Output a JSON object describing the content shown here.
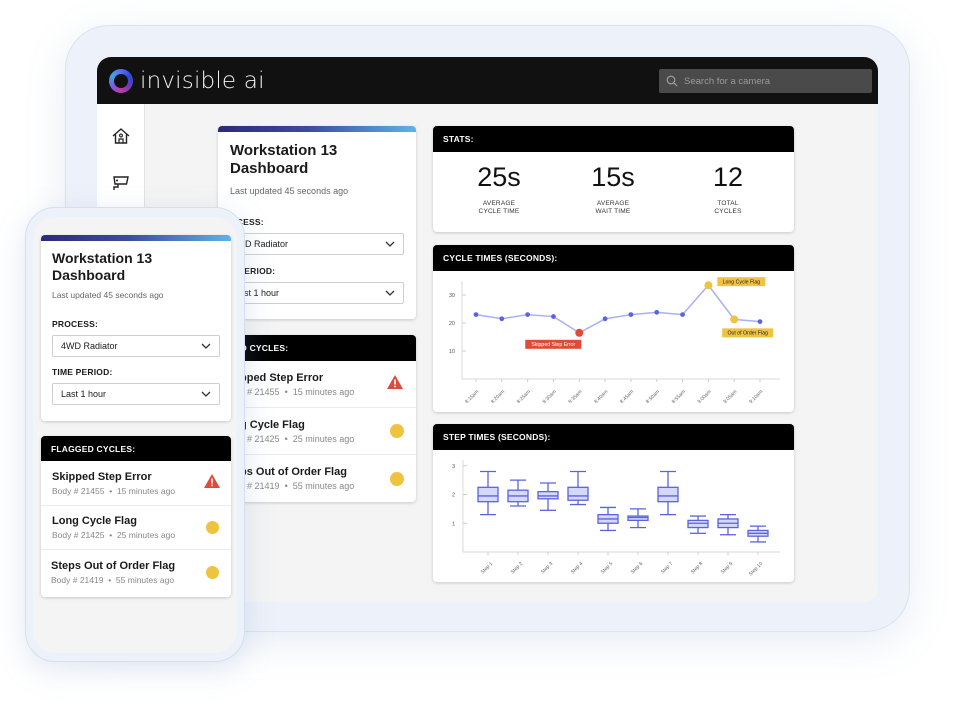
{
  "app": {
    "brand": "invisible ai",
    "search_placeholder": "Search for a camera"
  },
  "sidebar": {
    "items": [
      {
        "icon": "home-icon"
      },
      {
        "icon": "camera-icon"
      }
    ]
  },
  "dashboard": {
    "title_line1": "Workstation 13",
    "title_line2": "Dashboard",
    "last_updated": "Last updated 45 seconds ago",
    "process_label": "PROCESS:",
    "process_value": "4WD Radiator",
    "time_period_label": "TIME PERIOD:",
    "time_period_value": "Last 1 hour"
  },
  "tablet_partial": {
    "process_label": "OCESS:",
    "process_value": "VD Radiator",
    "time_period_label": "E PERIOD:",
    "time_period_value": "ast 1 hour",
    "flagged_header": "GED CYCLES:",
    "flags": [
      {
        "title": "pped Step Error",
        "body": "y # 21455",
        "time": "15 minutes ago"
      },
      {
        "title": "g Cycle Flag",
        "body": "y # 21425",
        "time": "25 minutes ago"
      },
      {
        "title": "ps Out of Order Flag",
        "body": "y # 21419",
        "time": "55 minutes ago"
      }
    ]
  },
  "flagged": {
    "header": "FLAGGED CYCLES:",
    "separator": "•",
    "items": [
      {
        "title": "Skipped Step Error",
        "body": "Body # 21455",
        "time": "15 minutes ago",
        "severity": "error",
        "icon": "warning-icon"
      },
      {
        "title": "Long Cycle Flag",
        "body": "Body # 21425",
        "time": "25 minutes ago",
        "severity": "flag",
        "icon": "yellow-dot-icon"
      },
      {
        "title": "Steps Out of Order Flag",
        "body": "Body # 21419",
        "time": "55 minutes ago",
        "severity": "flag",
        "icon": "yellow-dot-icon"
      }
    ]
  },
  "stats": {
    "header": "STATS:",
    "items": [
      {
        "value": "25s",
        "label1": "AVERAGE",
        "label2": "CYCLE TIME"
      },
      {
        "value": "15s",
        "label1": "AVERAGE",
        "label2": "WAIT TIME"
      },
      {
        "value": "12",
        "label1": "TOTAL",
        "label2": "CYCLES"
      }
    ]
  },
  "colors": {
    "series": "#5b63e0",
    "line": "#a9b0f2",
    "error": "#de4b39",
    "flag": "#eec33f",
    "box_fill": "#d5d8f7"
  },
  "chart_data": [
    {
      "type": "line",
      "title": "CYCLE TIMES (SECONDS):",
      "xlabel": "",
      "ylabel": "",
      "x": [
        "8:15am",
        "8:20am",
        "8:25am",
        "8:30am",
        "8:35am",
        "8:40am",
        "8:45am",
        "8:50am",
        "8:55am",
        "9:00am",
        "9:05am",
        "9:10am"
      ],
      "values": [
        23,
        21.5,
        23,
        22.3,
        16.5,
        21.5,
        23,
        23.8,
        23,
        33.5,
        21.3,
        20.5
      ],
      "ylim": [
        0,
        35
      ],
      "yticks": [
        10,
        20,
        30
      ],
      "grid": false,
      "annotations": [
        {
          "index": 4,
          "text": "Skipped Step Error",
          "type": "error"
        },
        {
          "index": 9,
          "text": "Long Cycle Flag",
          "type": "flag"
        },
        {
          "index": 10,
          "text": "Out of Order Flag",
          "type": "flag"
        }
      ]
    },
    {
      "type": "box",
      "title": "STEP TIMES (SECONDS):",
      "xlabel": "",
      "ylabel": "",
      "categories": [
        "Step 1",
        "Step 2",
        "Step 3",
        "Step 4",
        "Step 5",
        "Step 6",
        "Step 7",
        "Step 8",
        "Step 9",
        "Step 10"
      ],
      "series": [
        {
          "name": "Step 1",
          "min": 1.3,
          "q1": 1.75,
          "median": 1.95,
          "q3": 2.25,
          "max": 2.8
        },
        {
          "name": "Step 2",
          "min": 1.6,
          "q1": 1.75,
          "median": 1.95,
          "q3": 2.15,
          "max": 2.5
        },
        {
          "name": "Step 3",
          "min": 1.45,
          "q1": 1.85,
          "median": 1.95,
          "q3": 2.1,
          "max": 2.4
        },
        {
          "name": "Step 4",
          "min": 1.65,
          "q1": 1.8,
          "median": 1.95,
          "q3": 2.25,
          "max": 2.8
        },
        {
          "name": "Step 5",
          "min": 0.75,
          "q1": 1.0,
          "median": 1.15,
          "q3": 1.3,
          "max": 1.55
        },
        {
          "name": "Step 6",
          "min": 0.85,
          "q1": 1.1,
          "median": 1.2,
          "q3": 1.25,
          "max": 1.5
        },
        {
          "name": "Step 7",
          "min": 1.3,
          "q1": 1.75,
          "median": 1.95,
          "q3": 2.25,
          "max": 2.8
        },
        {
          "name": "Step 8",
          "min": 0.65,
          "q1": 0.85,
          "median": 1.0,
          "q3": 1.1,
          "max": 1.25
        },
        {
          "name": "Step 9",
          "min": 0.6,
          "q1": 0.85,
          "median": 1.0,
          "q3": 1.15,
          "max": 1.3
        },
        {
          "name": "Step 10",
          "min": 0.35,
          "q1": 0.55,
          "median": 0.65,
          "q3": 0.75,
          "max": 0.9
        }
      ],
      "ylim": [
        0,
        3.2
      ],
      "yticks": [
        1,
        2,
        3
      ],
      "grid": false
    }
  ]
}
